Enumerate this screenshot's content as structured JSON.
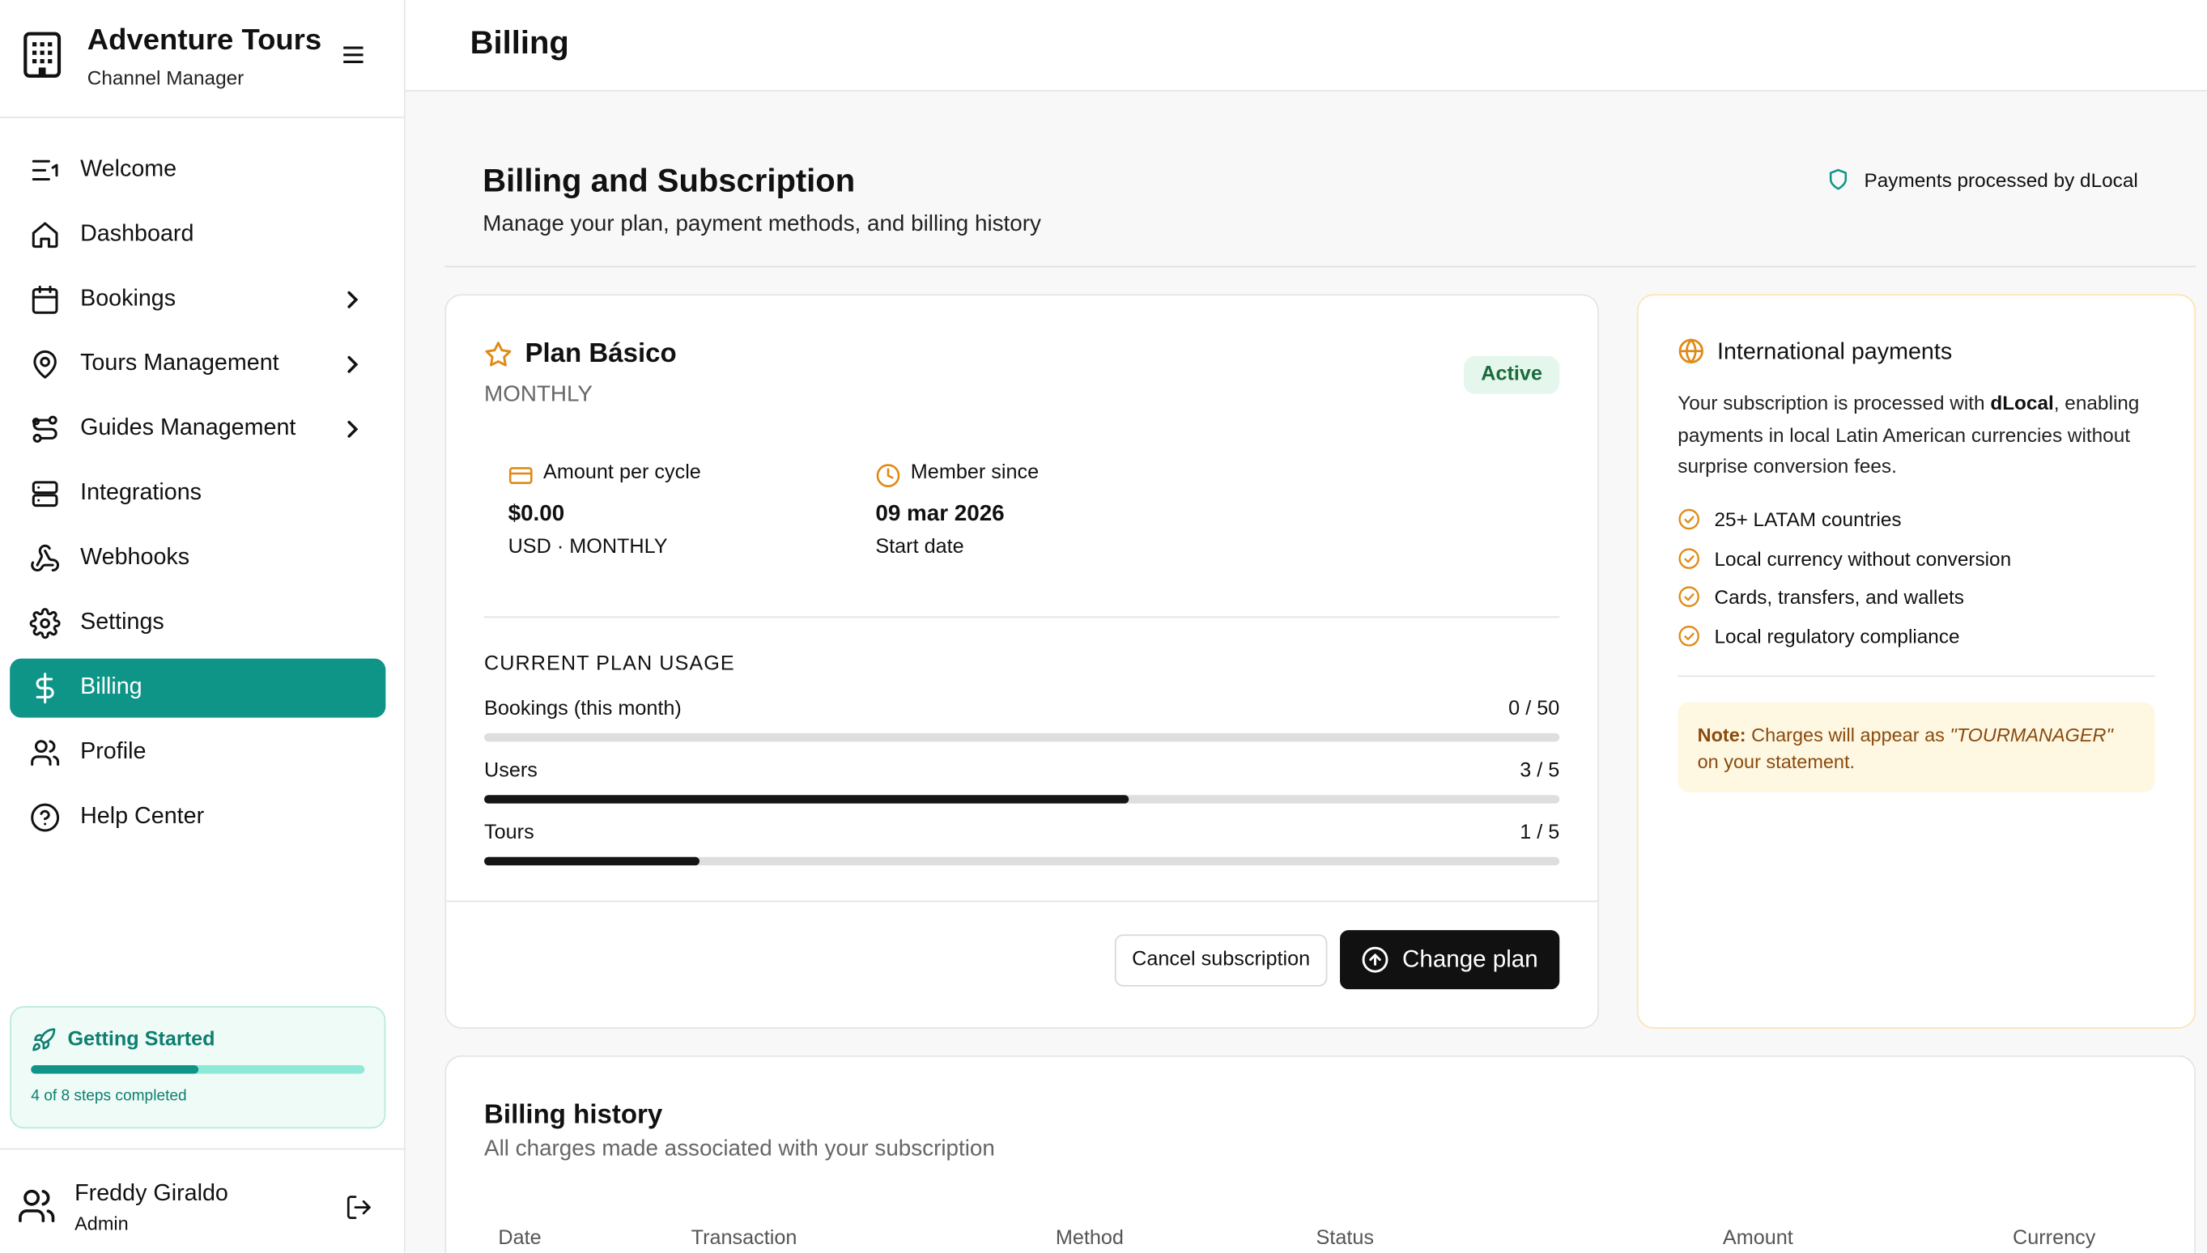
{
  "brand": {
    "title": "Adventure Tours",
    "subtitle": "Channel Manager"
  },
  "nav": [
    {
      "label": "Welcome",
      "icon": "list-start-icon",
      "chevron": false,
      "active": false
    },
    {
      "label": "Dashboard",
      "icon": "home-icon",
      "chevron": false,
      "active": false
    },
    {
      "label": "Bookings",
      "icon": "calendar-icon",
      "chevron": true,
      "active": false
    },
    {
      "label": "Tours Management",
      "icon": "map-pin-icon",
      "chevron": true,
      "active": false
    },
    {
      "label": "Guides Management",
      "icon": "route-icon",
      "chevron": true,
      "active": false
    },
    {
      "label": "Integrations",
      "icon": "server-icon",
      "chevron": false,
      "active": false
    },
    {
      "label": "Webhooks",
      "icon": "webhook-icon",
      "chevron": false,
      "active": false
    },
    {
      "label": "Settings",
      "icon": "gear-icon",
      "chevron": false,
      "active": false
    },
    {
      "label": "Billing",
      "icon": "dollar-icon",
      "chevron": false,
      "active": true
    },
    {
      "label": "Profile",
      "icon": "users-icon",
      "chevron": false,
      "active": false
    },
    {
      "label": "Help Center",
      "icon": "help-circle-icon",
      "chevron": false,
      "active": false
    }
  ],
  "getting_started": {
    "title": "Getting Started",
    "progress_text": "4 of 8 steps completed",
    "completed": 4,
    "total": 8
  },
  "user": {
    "name": "Freddy Giraldo",
    "role": "Admin"
  },
  "page": {
    "title": "Billing"
  },
  "header": {
    "title": "Billing and Subscription",
    "subtitle": "Manage your plan, payment methods, and billing history",
    "processor_note": "Payments processed by dLocal"
  },
  "plan": {
    "name": "Plan Básico",
    "cycle": "MONTHLY",
    "status": "Active",
    "amount_label": "Amount per cycle",
    "amount_value": "$0.00",
    "amount_sub": "USD · MONTHLY",
    "member_label": "Member since",
    "member_value": "09 mar 2026",
    "member_sub": "Start date",
    "usage_heading": "CURRENT PLAN USAGE",
    "usage": [
      {
        "label": "Bookings (this month)",
        "value_text": "0 / 50",
        "used": 0,
        "limit": 50
      },
      {
        "label": "Users",
        "value_text": "3 / 5",
        "used": 3,
        "limit": 5
      },
      {
        "label": "Tours",
        "value_text": "1 / 5",
        "used": 1,
        "limit": 5
      }
    ],
    "cancel_label": "Cancel subscription",
    "change_label": "Change plan"
  },
  "international": {
    "title": "International payments",
    "body_before": "Your subscription is processed with ",
    "body_bold": "dLocal",
    "body_after": ", enabling payments in local Latin American currencies without surprise conversion fees.",
    "features": [
      "25+ LATAM countries",
      "Local currency without conversion",
      "Cards, transfers, and wallets",
      "Local regulatory compliance"
    ],
    "note_label": "Note:",
    "note_before": " Charges will appear as ",
    "note_descriptor": "\"TOURMANAGER\"",
    "note_after": " on your statement."
  },
  "history": {
    "title": "Billing history",
    "subtitle": "All charges made associated with your subscription",
    "columns": [
      "Date",
      "Transaction",
      "Method",
      "Status",
      "Amount",
      "Currency"
    ]
  },
  "colors": {
    "accent": "#0f9488",
    "warning": "#e08a14",
    "dark": "#111111"
  }
}
